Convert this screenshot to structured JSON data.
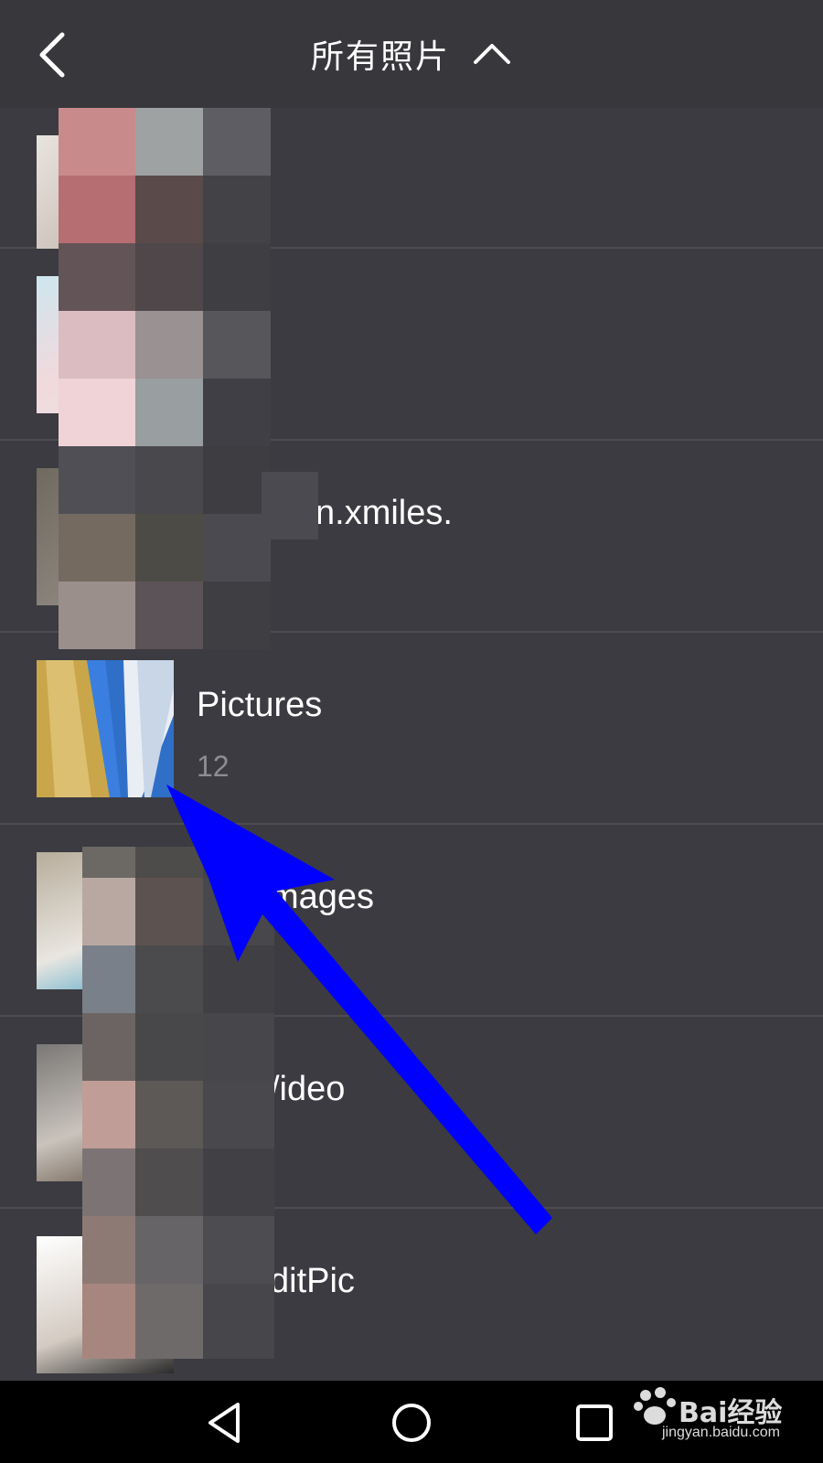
{
  "header": {
    "title": "所有照片",
    "back_icon": "back-arrow-icon",
    "toggle_icon": "chevron-up-icon"
  },
  "albums": [
    {
      "name": "",
      "count": ""
    },
    {
      "name": "",
      "count": ""
    },
    {
      "name": "n.xmiles.",
      "count": ""
    },
    {
      "name": "Pictures",
      "count": "12"
    },
    {
      "name": "mages",
      "count": ""
    },
    {
      "name": "/ideo",
      "count": ""
    },
    {
      "name": "ditPic",
      "count": ""
    }
  ],
  "navbar": {
    "back": "nav-back-icon",
    "home": "nav-home-icon",
    "recents": "nav-recents-icon"
  },
  "watermark": {
    "brand": "Bai经验",
    "site": "jingyan.baidu.com"
  },
  "colors": {
    "background": "#3b3b41",
    "header": "#37373c",
    "annotation_arrow": "#0000ff"
  }
}
